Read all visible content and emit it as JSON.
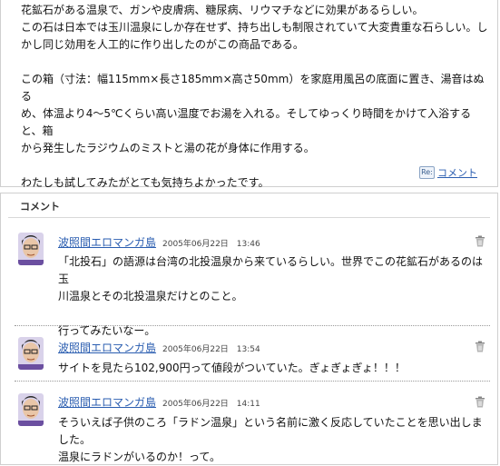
{
  "article": {
    "lines": [
      "花鉱石がある温泉で、ガンや皮膚病、糖尿病、リウマチなどに効果があるらしい。",
      "この石は日本では玉川温泉にしか存在せず、持ち出しも制限されていて大変貴重な石らしい。し",
      "かし同じ効用を人工的に作り出したのがこの商品である。",
      "",
      "この箱（寸法：幅115mm×長さ185mm×高さ50mm）を家庭用風呂の底面に置き、湯音はぬる",
      "め、体温より4～5℃くらい高い温度でお湯を入れる。そしてゆっくり時間をかけて入浴すると、箱",
      "から発生したラジウムのミストと湯の花が身体に作用する。",
      "",
      "わたしも試してみたがとても気持ちよかったです。"
    ],
    "comment_link_label": "コメント",
    "re_icon_label": "Re:"
  },
  "comments_section": {
    "title": "コメント",
    "items": [
      {
        "author": "波照間エロマンガ島",
        "date": "2005年06月22日　13:46",
        "lines": [
          "「北投石」の語源は台湾の北投温泉から来ているらしい。世界でこの花鉱石があるのは玉",
          "川温泉とその北投温泉だけとのこと。",
          "",
          "行ってみたいなー。"
        ]
      },
      {
        "author": "波照間エロマンガ島",
        "date": "2005年06月22日　13:54",
        "lines": [
          "サイトを見たら102,900円って値段がついていた。ぎょぎょぎょ！！！"
        ]
      },
      {
        "author": "波照間エロマンガ島",
        "date": "2005年06月22日　14:11",
        "lines": [
          "そういえば子供のころ「ラドン温泉」という名前に激く反応していたことを思い出しました。",
          "温泉にラドンがいるのか！って。"
        ]
      }
    ]
  },
  "colors": {
    "link": "#2a5db0",
    "border": "#cfcfcf",
    "text": "#111111"
  },
  "icons": {
    "avatar": "avatar-face-icon",
    "delete": "trash-icon",
    "reply": "re-icon"
  }
}
